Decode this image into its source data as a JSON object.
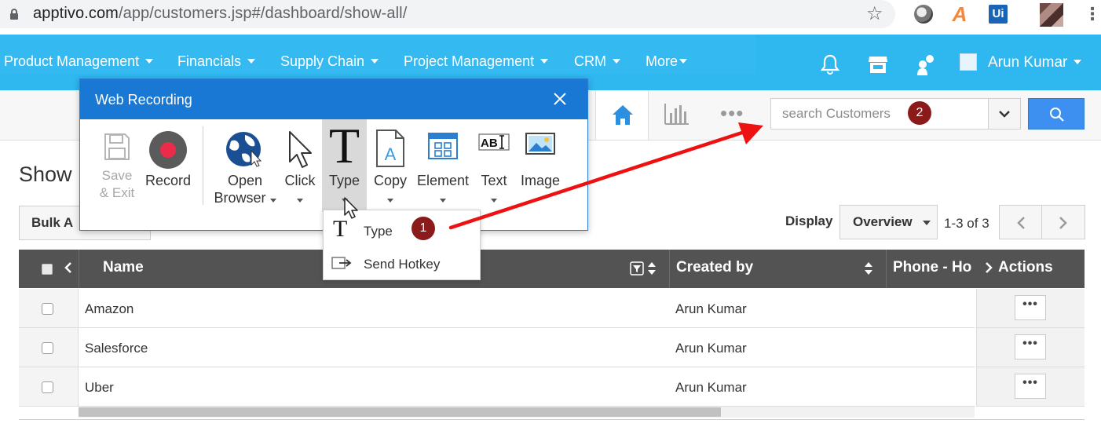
{
  "browser": {
    "url_host": "apptivo.com",
    "url_path": "/app/customers.jsp#/dashboard/show-all/",
    "icons": [
      "lock-icon",
      "star-icon",
      "extension-icon",
      "acrobat-icon",
      "uipath-icon",
      "profile-avatar",
      "menu-icon"
    ],
    "ext_a": "A",
    "ext_ui": "Ui",
    "menu_glyph": "⋮",
    "star_glyph": "☆"
  },
  "topnav": {
    "items": [
      {
        "label": "Product Management"
      },
      {
        "label": "Financials"
      },
      {
        "label": "Supply Chain"
      },
      {
        "label": "Project Management"
      },
      {
        "label": "CRM"
      },
      {
        "label": "More"
      }
    ],
    "user": "Arun Kumar",
    "accent": "#2fb7ef"
  },
  "subbar": {
    "search_placeholder": "search Customers",
    "dots": "•••"
  },
  "page": {
    "title": "Show",
    "bulk_label": "Bulk A",
    "display_label": "Display",
    "view_select": "Overview",
    "page_info": "1-3 of 3"
  },
  "table": {
    "headers": {
      "name": "Name",
      "created_by": "Created by",
      "phone": "Phone - Ho",
      "actions": "Actions"
    },
    "rows": [
      {
        "name": "Amazon",
        "created_by": "Arun Kumar",
        "action": "•••"
      },
      {
        "name": "Salesforce",
        "created_by": "Arun Kumar",
        "action": "•••"
      },
      {
        "name": "Uber",
        "created_by": "Arun Kumar",
        "action": "•••"
      }
    ]
  },
  "web_recording": {
    "title": "Web Recording",
    "tools": {
      "save_line1": "Save",
      "save_line2": "& Exit",
      "record": "Record",
      "open_line1": "Open",
      "open_line2": "Browser",
      "click": "Click",
      "type": "Type",
      "copy": "Copy",
      "element": "Element",
      "text": "Text",
      "image": "Image"
    },
    "type_menu": [
      {
        "label": "Type"
      },
      {
        "label": "Send Hotkey"
      }
    ],
    "accent": "#1978d4"
  },
  "annotations": {
    "badge1": "1",
    "badge2": "2",
    "badge_color": "#8b1a1a",
    "arrow_color": "#ee1111"
  }
}
